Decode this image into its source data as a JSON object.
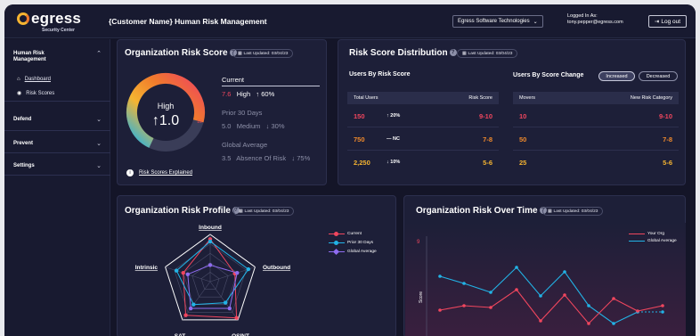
{
  "header": {
    "logo_text": "egress",
    "logo_sub": "Security Center",
    "title": "{Customer Name} Human Risk Management",
    "org_select": "Egress Software Technologies",
    "logged_label": "Logged In As:",
    "logged_user": "tony.pepper@egress.com",
    "logout": "Log out"
  },
  "sidebar": {
    "group_hrm": "Human Risk Management",
    "dashboard": "Dashboard",
    "risk_scores": "Risk Scores",
    "defend": "Defend",
    "prevent": "Prevent",
    "settings": "Settings"
  },
  "org_risk_score": {
    "title": "Organization Risk Score",
    "updated": "Last Updated: 03/04/23",
    "gauge_level": "High",
    "gauge_value": "↑1.0",
    "gauge_max": "10",
    "gauge_fraction": 0.76,
    "current_label": "Current",
    "current_value": "7.6",
    "current_level": "High",
    "current_change": "↑ 60%",
    "prior_label": "Prior 30 Days",
    "prior_value": "5.0",
    "prior_level": "Medium",
    "prior_change": "↓ 30%",
    "global_label": "Global Average",
    "global_value": "3.5",
    "global_level": "Absence Of Risk",
    "global_change": "↓ 75%",
    "explained": "Risk Scores Explained"
  },
  "distribution": {
    "title": "Risk Score Distribution",
    "updated": "Last Updated: 03/04/23",
    "by_score_title": "Users By Risk Score",
    "col_total": "Total Users",
    "col_score": "Risk Score",
    "rows": [
      {
        "users": "150",
        "change": "↑ 20%",
        "score": "9-10"
      },
      {
        "users": "750",
        "change": "— NC",
        "score": "7-8"
      },
      {
        "users": "2,250",
        "change": "↓ 10%",
        "score": "5-6"
      }
    ],
    "by_change_title": "Users By Score Change",
    "toggle_increased": "Increased",
    "toggle_decreased": "Decreased",
    "col_movers": "Movers",
    "col_category": "New Risk Category",
    "movers": [
      {
        "movers": "10",
        "category": "9-10"
      },
      {
        "movers": "50",
        "category": "7-8"
      },
      {
        "movers": "25",
        "category": "5-6"
      }
    ]
  },
  "profile": {
    "title": "Organization Risk Profile",
    "updated": "Last Updated: 03/04/23",
    "axes": [
      "Inbound",
      "Outbound",
      "OSINT",
      "SAT",
      "Intrinsic"
    ],
    "legend": [
      "Current",
      "Prior 30 Days",
      "Global Average"
    ],
    "colors": [
      "#f0465e",
      "#22b3e6",
      "#8f6cf0"
    ]
  },
  "over_time": {
    "title": "Organization Risk Over Time",
    "updated": "Last Updated: 03/04/23",
    "y_top_tick": "9",
    "ylabel": "Score",
    "legend": [
      "Your Org",
      "Global Average"
    ]
  }
}
